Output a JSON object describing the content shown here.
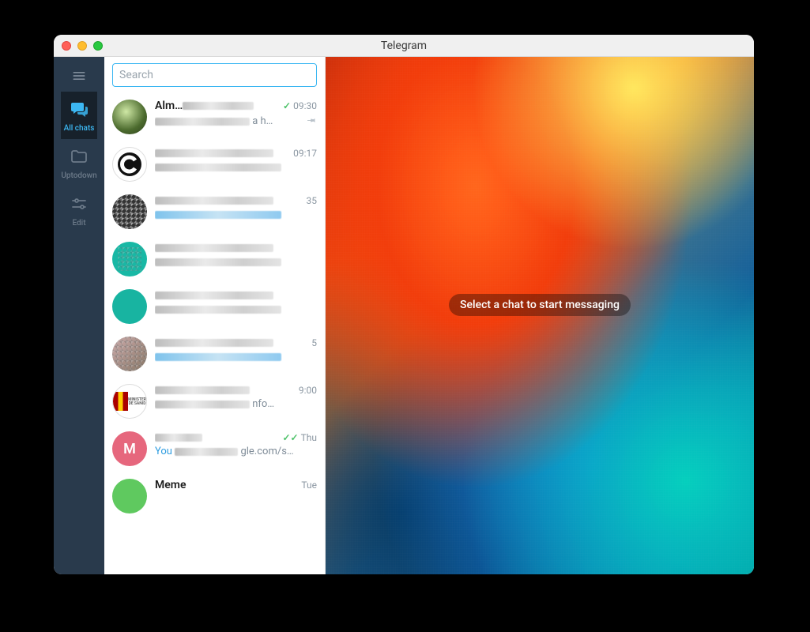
{
  "window": {
    "title": "Telegram"
  },
  "sidebar": {
    "items": [
      {
        "key": "all-chats",
        "label": "All chats",
        "icon": "chats-icon",
        "active": true
      },
      {
        "key": "uptodown",
        "label": "Uptodown",
        "icon": "folder-icon",
        "active": false
      },
      {
        "key": "edit",
        "label": "Edit",
        "icon": "sliders-icon",
        "active": false
      }
    ]
  },
  "search": {
    "placeholder": "Search",
    "value": ""
  },
  "chats": [
    {
      "name": "Alm…",
      "name_blur_w": 90,
      "time": "09:30",
      "status": "sent",
      "preview_blur_w": 120,
      "preview_suffix": "a h…",
      "pinned": true,
      "avatar": {
        "type": "photo-green"
      }
    },
    {
      "name": "",
      "name_blur_w": 150,
      "time": "09:17",
      "status": "none",
      "preview_blur_w": 160,
      "preview_suffix": "",
      "pinned": false,
      "avatar": {
        "type": "c-logo"
      }
    },
    {
      "name": "",
      "name_blur_w": 150,
      "time": "35",
      "status": "none",
      "preview_blur_w": 160,
      "preview_suffix": "",
      "pinned": false,
      "preview_blue": true,
      "avatar": {
        "type": "pix-dark"
      }
    },
    {
      "name": "",
      "name_blur_w": 150,
      "time": "",
      "status": "none",
      "preview_blur_w": 160,
      "preview_suffix": "",
      "pinned": false,
      "avatar": {
        "type": "teal-square"
      }
    },
    {
      "name": "",
      "name_blur_w": 150,
      "time": "",
      "status": "none",
      "preview_blur_w": 160,
      "preview_suffix": "",
      "pinned": false,
      "avatar": {
        "type": "teal-round"
      }
    },
    {
      "name": "",
      "name_blur_w": 150,
      "time": "5",
      "status": "none",
      "preview_blur_w": 160,
      "preview_suffix": "",
      "pinned": false,
      "preview_blue": true,
      "avatar": {
        "type": "pix-person"
      }
    },
    {
      "name": "",
      "name_blur_w": 120,
      "time": "9:00",
      "status": "none",
      "preview_blur_w": 120,
      "preview_suffix": "nfo…",
      "pinned": false,
      "avatar": {
        "type": "minister"
      }
    },
    {
      "name": "",
      "name_blur_w": 60,
      "time": "Thu",
      "status": "read",
      "preview_prefix": "You",
      "preview_blur_w": 80,
      "preview_suffix": "gle.com/s…",
      "pinned": false,
      "avatar": {
        "type": "letter",
        "letter": "M",
        "bg": "#e6677d"
      }
    },
    {
      "name": "Meme",
      "name_blur_w": 0,
      "time": "Tue",
      "status": "none",
      "preview_blur_w": 0,
      "preview_suffix": "",
      "pinned": false,
      "avatar": {
        "type": "solid",
        "bg": "#5fc95f"
      }
    }
  ],
  "main": {
    "empty_message": "Select a chat to start messaging"
  }
}
